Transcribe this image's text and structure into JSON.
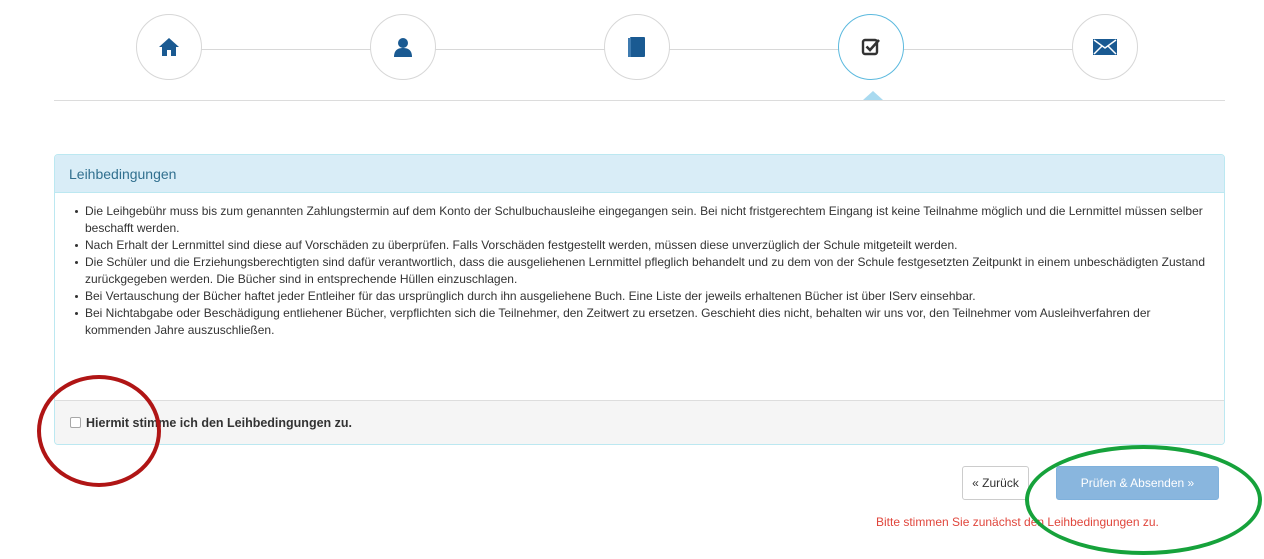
{
  "wizard": {
    "steps": [
      {
        "icon": "home-icon",
        "active": false
      },
      {
        "icon": "user-icon",
        "active": false
      },
      {
        "icon": "book-icon",
        "active": false
      },
      {
        "icon": "check-square-icon",
        "active": true
      },
      {
        "icon": "envelope-icon",
        "active": false
      }
    ],
    "colors": {
      "icon": "#1a5a92",
      "active_border": "#5bb9de",
      "active_icon": "#333333"
    }
  },
  "panel": {
    "title": "Leihbedingungen",
    "items": [
      "Die Leihgebühr muss bis zum genannten Zahlungstermin auf dem Konto der Schulbuchausleihe eingegangen sein. Bei nicht fristgerechtem Eingang ist keine Teilnahme möglich und die Lernmittel müssen selber beschafft werden.",
      "Nach Erhalt der Lernmittel sind diese auf Vorschäden zu überprüfen. Falls Vorschäden festgestellt werden, müssen diese unverzüglich der Schule mitgeteilt werden.",
      "Die Schüler und die Erziehungsberechtigten sind dafür verantwortlich, dass die ausgeliehenen Lernmittel pfleglich behandelt und zu dem von der Schule festgesetzten Zeitpunkt in einem unbeschädigten Zustand zurückgegeben werden. Die Bücher sind in entsprechende Hüllen einzuschlagen.",
      "Bei Vertauschung der Bücher haftet jeder Entleiher für das ursprünglich durch ihn ausgeliehene Buch. Eine Liste der jeweils erhaltenen Bücher ist über IServ einsehbar.",
      "Bei Nichtabgabe oder Beschädigung entliehener Bücher, verpflichten sich die Teilnehmer, den Zeitwert zu ersetzen. Geschieht dies nicht, behalten wir uns vor, den Teilnehmer vom Ausleihverfahren der kommenden Jahre auszuschließen."
    ],
    "checkbox_label": "Hiermit stimme ich den Leihbedingungen zu.",
    "checkbox_checked": false
  },
  "actions": {
    "back_label": "« Zurück",
    "submit_label": "Prüfen & Absenden »",
    "hint": "Bitte stimmen Sie zunächst den Leihbedingungen zu."
  },
  "annotations": {
    "red": "#b01515",
    "green": "#16a23b"
  }
}
